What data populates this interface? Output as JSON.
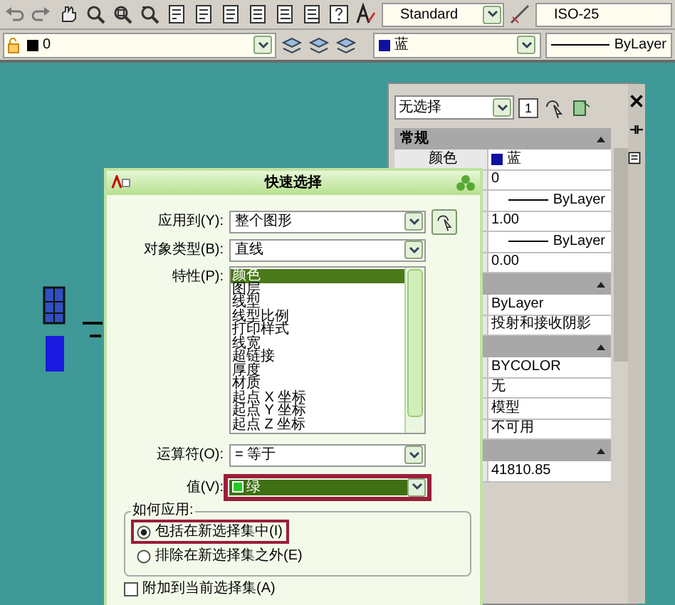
{
  "toolbar": {
    "text_style": "Standard",
    "dim_style": "ISO-25"
  },
  "layer_bar": {
    "layer": "0",
    "color_name": "蓝",
    "color": "#1010a0",
    "linetype": "ByLayer"
  },
  "properties": {
    "selection": "无选择",
    "count_button": "1",
    "sections": [
      {
        "title": "常规",
        "expanded": true,
        "rows": [
          {
            "kind": "color",
            "label": "颜色",
            "value": "蓝",
            "color": "#1010a0"
          },
          {
            "kind": "text",
            "value": "0"
          },
          {
            "kind": "linetype",
            "value": "ByLayer"
          },
          {
            "kind": "text",
            "value": "1.00"
          },
          {
            "kind": "linetype",
            "value": "ByLayer"
          },
          {
            "kind": "text",
            "value": "0.00"
          }
        ]
      },
      {
        "expanded": true,
        "rows": [
          {
            "kind": "text",
            "value": "ByLayer"
          },
          {
            "kind": "text",
            "value": "投射和接收阴影"
          }
        ]
      },
      {
        "expanded": true,
        "rows": [
          {
            "kind": "text",
            "value": "BYCOLOR"
          },
          {
            "kind": "text",
            "value": "无"
          },
          {
            "kind": "text",
            "value": "模型"
          },
          {
            "kind": "text",
            "value": "不可用"
          }
        ]
      },
      {
        "expanded": true,
        "rows": [
          {
            "kind": "text",
            "value": "41810.85"
          }
        ]
      }
    ]
  },
  "dialog": {
    "title": "快速选择",
    "apply_to": {
      "label": "应用到(Y):",
      "value": "整个图形"
    },
    "object_type": {
      "label": "对象类型(B):",
      "value": "直线"
    },
    "properties": {
      "label": "特性(P):",
      "items": [
        {
          "text": "颜色",
          "selected": true
        },
        {
          "text": "图层",
          "selected": false
        },
        {
          "text": "线型",
          "selected": false
        },
        {
          "text": "线型比例",
          "selected": false
        },
        {
          "text": "打印样式",
          "selected": false
        },
        {
          "text": "线宽",
          "selected": false
        },
        {
          "text": "超链接",
          "selected": false
        },
        {
          "text": "厚度",
          "selected": false
        },
        {
          "text": "材质",
          "selected": false
        },
        {
          "text": "起点 X 坐标",
          "selected": false
        },
        {
          "text": "起点 Y 坐标",
          "selected": false
        },
        {
          "text": "起点 Z 坐标",
          "selected": false
        }
      ]
    },
    "operator": {
      "label": "运算符(O):",
      "value": "= 等于"
    },
    "value": {
      "label": "值(V):",
      "value": "绿",
      "color": "#22cc22",
      "highlighted": true
    },
    "how_to_apply": {
      "title": "如何应用:",
      "options": [
        {
          "text": "包括在新选择集中(I)",
          "selected": true,
          "highlighted": true
        },
        {
          "text": "排除在新选择集之外(E)",
          "selected": false,
          "highlighted": false
        }
      ]
    },
    "append": {
      "text": "附加到当前选择集(A)",
      "checked": false
    }
  }
}
